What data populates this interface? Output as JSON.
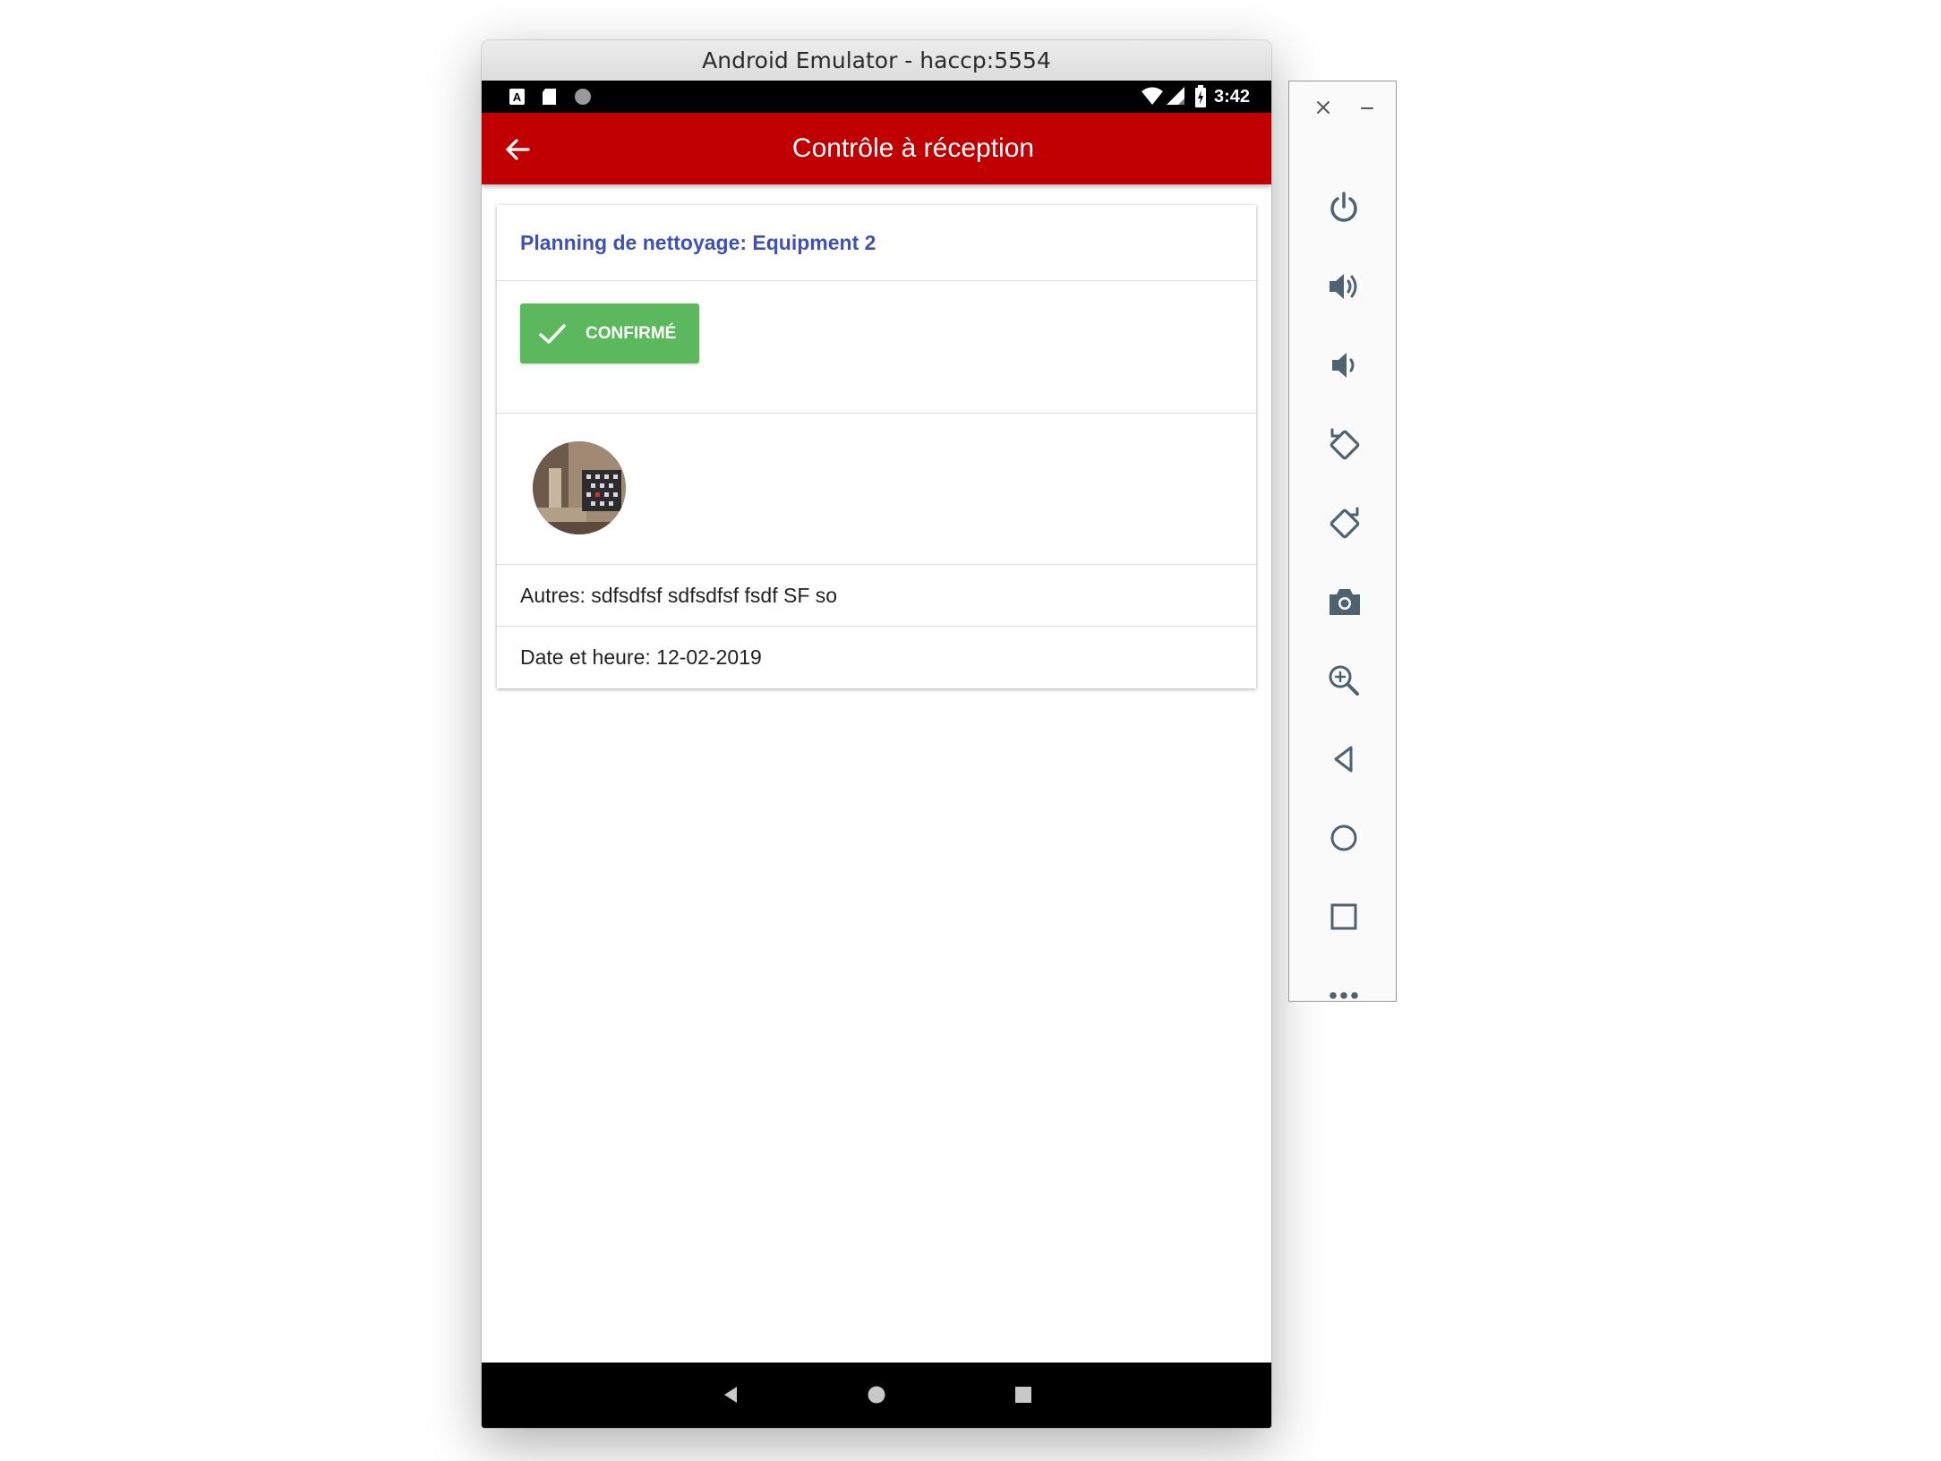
{
  "window": {
    "title": "Android Emulator - haccp:5554"
  },
  "status_bar": {
    "time": "3:42",
    "left_icons": [
      "a-notification-icon",
      "sd-card-icon",
      "circle-notification-icon"
    ],
    "right_icons": [
      "wifi-icon",
      "signal-icon",
      "battery-icon"
    ]
  },
  "app_bar": {
    "title": "Contrôle à réception",
    "back_icon": "arrow-left-icon",
    "color": "#c00000"
  },
  "card": {
    "title": "Planning de nettoyage: Equipment 2",
    "title_color": "#3f51b5",
    "confirm_button": {
      "label": "CONFIRMÉ",
      "color": "#5cb85c",
      "icon": "check-icon"
    },
    "photo": "equipment-photo-thumbnail",
    "other_row": "Autres: sdfsdfsf sdfsdfsf fsdf SF so",
    "date_row": "Date et heure: 12-02-2019"
  },
  "nav_bar": {
    "buttons": [
      "back-triangle-icon",
      "home-circle-icon",
      "recents-square-icon"
    ]
  },
  "side_toolbar": {
    "top_buttons": [
      "close-icon",
      "minimize-icon"
    ],
    "buttons": [
      "power-icon",
      "volume-up-icon",
      "volume-down-icon",
      "rotate-left-icon",
      "rotate-right-icon",
      "camera-icon",
      "zoom-icon",
      "back-icon",
      "home-icon",
      "overview-icon",
      "more-icon"
    ]
  }
}
